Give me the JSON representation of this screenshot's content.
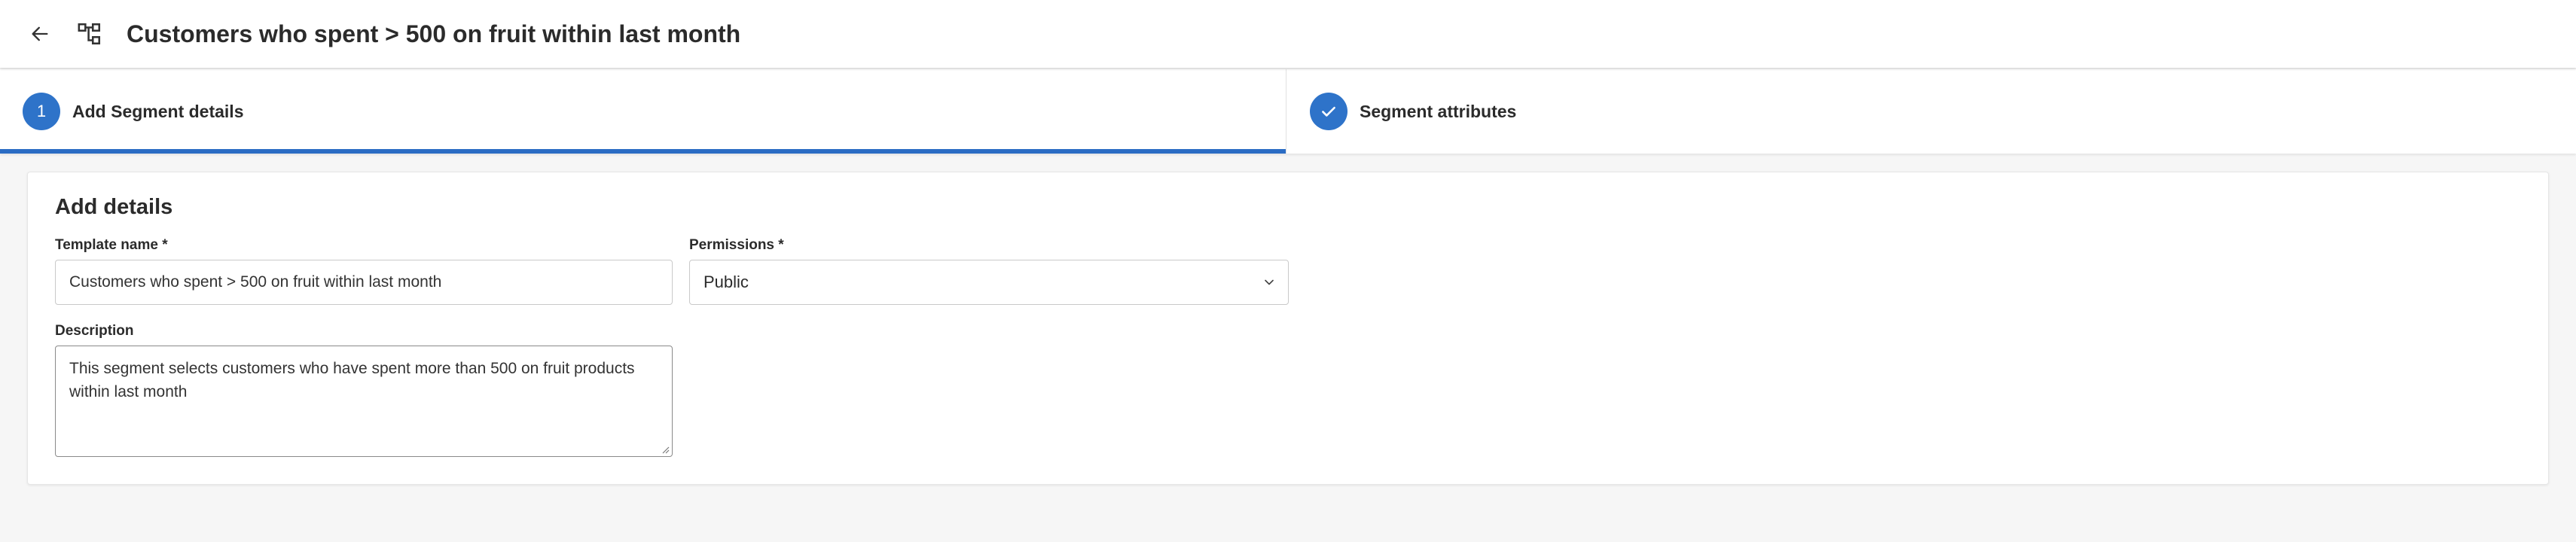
{
  "header": {
    "title": "Customers who spent > 500 on fruit within last month",
    "back_icon": "arrow-left-icon",
    "flow_icon": "hierarchy-icon"
  },
  "stepper": {
    "steps": [
      {
        "number": "1",
        "label": "Add Segment details",
        "state": "active"
      },
      {
        "number": "",
        "label": "Segment attributes",
        "state": "completed",
        "icon": "check-icon"
      }
    ]
  },
  "form": {
    "title": "Add details",
    "template_name": {
      "label": "Template name *",
      "value": "Customers who spent > 500 on fruit within last month"
    },
    "permissions": {
      "label": "Permissions *",
      "value": "Public"
    },
    "description": {
      "label": "Description",
      "value": "This segment selects customers who have spent more than 500 on fruit products within last month"
    }
  },
  "colors": {
    "accent": "#2e73c9",
    "underline": "#2b6cc4",
    "background": "#f6f6f6"
  }
}
